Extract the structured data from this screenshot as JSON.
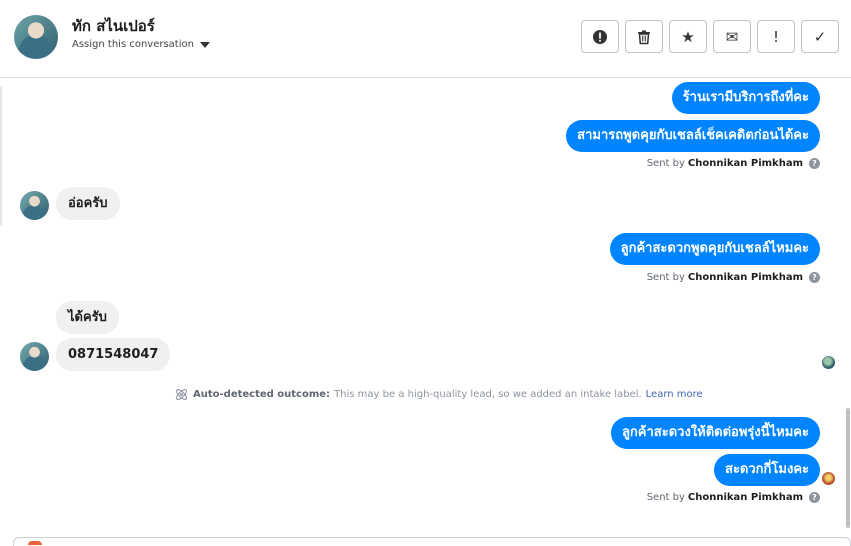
{
  "header": {
    "contact_name": "ทัก สไนเปอร์",
    "assign_label": "Assign this conversation"
  },
  "toolbar": {
    "buttons": [
      {
        "icon": "alert-circle-icon",
        "glyph": "!"
      },
      {
        "icon": "trash-icon",
        "glyph": ""
      },
      {
        "icon": "star-icon",
        "glyph": "★"
      },
      {
        "icon": "envelope-icon",
        "glyph": "✉"
      },
      {
        "icon": "exclamation-icon",
        "glyph": "!"
      },
      {
        "icon": "checkmark-icon",
        "glyph": "✓"
      }
    ]
  },
  "messages": {
    "out_1": "ร้านเรามีบริการถึงที่คะ",
    "out_2": "สามารถพูดคุยกับเชลล์เช็คเคดิตก่อนได้คะ",
    "sent_1_prefix": "Sent by",
    "sent_1_agent": "Chonnikan Pimkham",
    "in_1": "อ่อครับ",
    "out_3": "ลูกค้าสะดวกพูดคุยกับเชลล์ไหมคะ",
    "sent_2_prefix": "Sent by",
    "sent_2_agent": "Chonnikan Pimkham",
    "in_2": "ได้ครับ",
    "in_3": "0871548047",
    "outcome_title": "Auto-detected outcome:",
    "outcome_text": "This may be a high-quality lead, so we added an intake label.",
    "outcome_link": "Learn more",
    "out_4": "ลูกค้าสะดวงให้ติดต่อพรุ่งนี้ไหมคะ",
    "out_5": "สะดวกกี่โมงคะ",
    "sent_3_prefix": "Sent by",
    "sent_3_agent": "Chonnikan Pimkham",
    "help_glyph": "?"
  },
  "colors": {
    "outgoing_bubble": "#0084ff",
    "incoming_bubble": "#f0f0f0",
    "link": "#4267b2"
  }
}
